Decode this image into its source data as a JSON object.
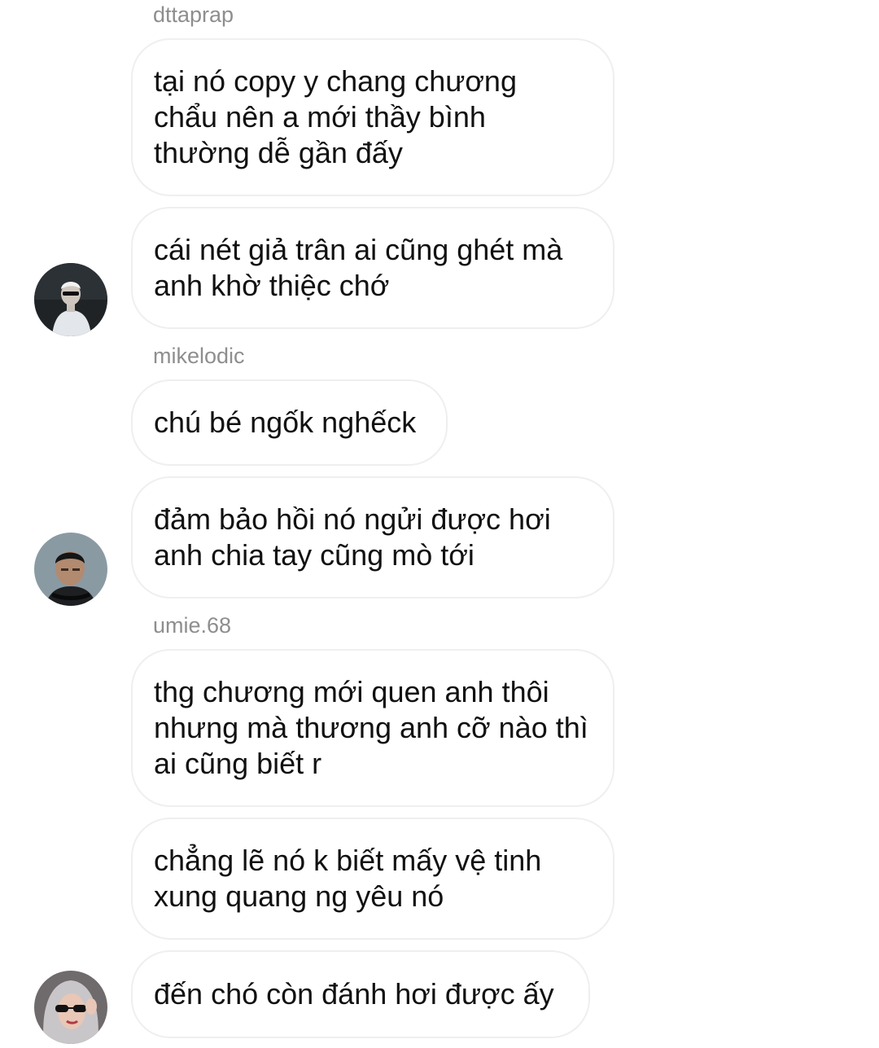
{
  "thread": {
    "groups": [
      {
        "username": "dttaprap",
        "avatar_icon": "user-avatar-icon",
        "messages": [
          "tại nó copy y chang chương chẩu nên a mới thầy bình thường dễ gần đấy",
          "cái nét giả trân ai cũng ghét mà anh khờ thiệc chớ"
        ]
      },
      {
        "username": "mikelodic",
        "avatar_icon": "user-avatar-icon",
        "messages": [
          "chú bé ngốk nghếck",
          "đảm bảo hồi nó ngửi được hơi anh chia tay cũng mò tới"
        ]
      },
      {
        "username": "umie.68",
        "avatar_icon": "user-avatar-icon",
        "messages": [
          "thg chương mới quen anh thôi nhưng mà thương anh cỡ nào thì ai cũng biết r",
          "chẳng lẽ nó k biết mấy vệ tinh xung quang ng yêu nó",
          "đến chó còn đánh hơi được ấy"
        ]
      }
    ]
  },
  "colors": {
    "bubble_border": "#efefef",
    "username_text": "#8e8e8e",
    "message_text": "#111111"
  }
}
